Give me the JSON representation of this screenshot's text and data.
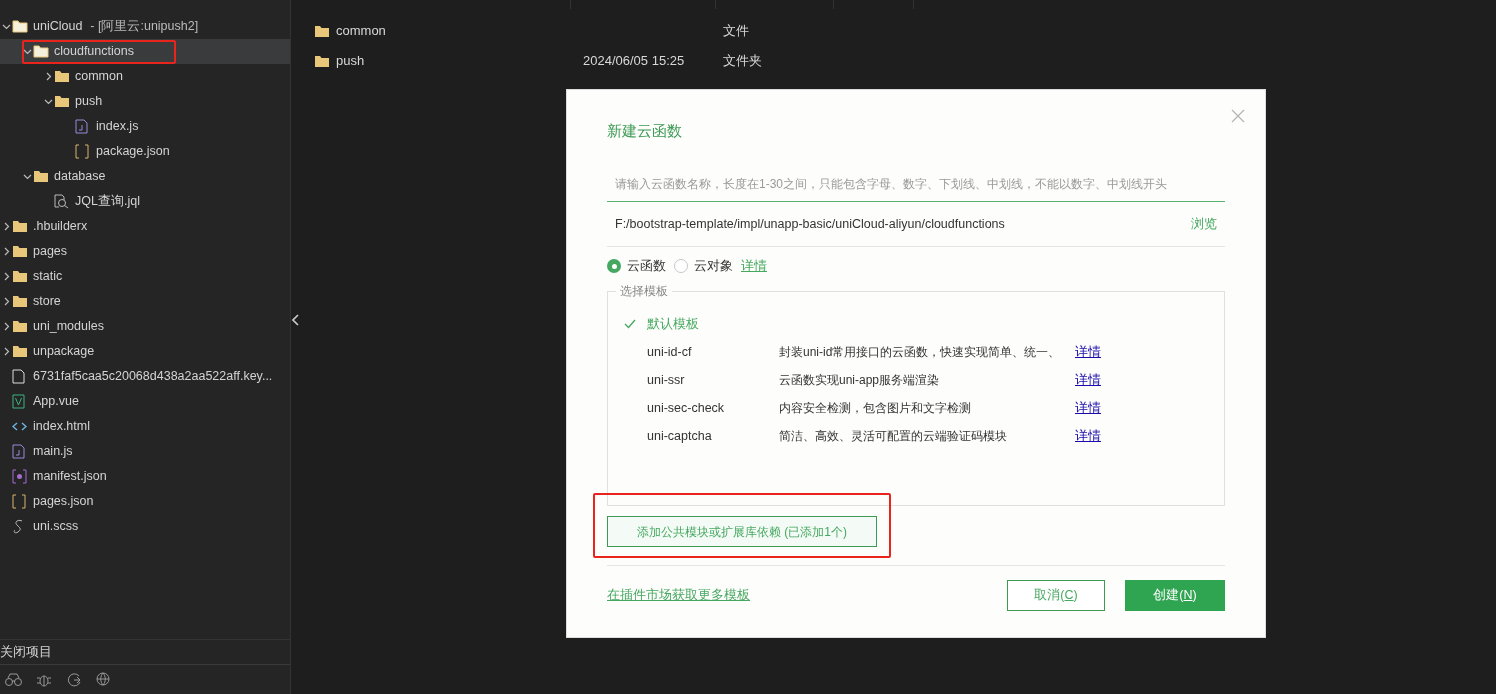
{
  "tree": [
    {
      "label": "uniCloud",
      "sublabel": "- [阿里云:unipush2]",
      "kind": "folder-open",
      "expanded": true,
      "selected": false,
      "children": [
        {
          "label": "cloudfunctions",
          "kind": "folder-open",
          "expanded": true,
          "selected": true,
          "annotated": true,
          "children": [
            {
              "label": "common",
              "kind": "folder",
              "expanded": false,
              "selected": false
            },
            {
              "label": "push",
              "kind": "folder",
              "expanded": true,
              "selected": false,
              "children": [
                {
                  "label": "index.js",
                  "kind": "js",
                  "selected": false
                },
                {
                  "label": "package.json",
                  "kind": "json",
                  "selected": false
                }
              ]
            }
          ]
        },
        {
          "label": "database",
          "kind": "folder",
          "expanded": true,
          "selected": false,
          "children": [
            {
              "label": "JQL查询.jql",
              "kind": "jql",
              "selected": false
            }
          ]
        }
      ]
    },
    {
      "label": ".hbuilderx",
      "kind": "folder",
      "expanded": false,
      "selected": false
    },
    {
      "label": "pages",
      "kind": "folder",
      "expanded": false,
      "selected": false
    },
    {
      "label": "static",
      "kind": "folder",
      "expanded": false,
      "selected": false
    },
    {
      "label": "store",
      "kind": "folder",
      "expanded": false,
      "selected": false
    },
    {
      "label": "uni_modules",
      "kind": "folder",
      "expanded": false,
      "selected": false
    },
    {
      "label": "unpackage",
      "kind": "folder",
      "expanded": false,
      "selected": false
    },
    {
      "label": "6731faf5caa5c20068d438a2aa522aff.key...",
      "kind": "file",
      "selected": false
    },
    {
      "label": "App.vue",
      "kind": "vue",
      "selected": false
    },
    {
      "label": "index.html",
      "kind": "html",
      "selected": false
    },
    {
      "label": "main.js",
      "kind": "js",
      "selected": false
    },
    {
      "label": "manifest.json",
      "kind": "manifest",
      "selected": false
    },
    {
      "label": "pages.json",
      "kind": "json",
      "selected": false
    },
    {
      "label": "uni.scss",
      "kind": "scss",
      "selected": false
    }
  ],
  "closed_projects": "关闭项目",
  "files": [
    {
      "name": "common",
      "type": "文件"
    },
    {
      "name": "push",
      "modified": "2024/06/05 15:25",
      "type": "文件夹"
    }
  ],
  "dialog": {
    "title": "新建云函数",
    "name_field": {
      "placeholder": "请输入云函数名称，长度在1-30之间，只能包含字母、数字、下划线、中划线，不能以数字、中划线开头"
    },
    "path": "F:/bootstrap-template/impl/unapp-basic/uniCloud-aliyun/cloudfunctions",
    "browse": "浏览",
    "types": [
      {
        "label": "云函数",
        "selected": true
      },
      {
        "label": "云对象",
        "selected": false
      }
    ],
    "types_link": "详情",
    "template_legend": "选择模板",
    "templates": [
      {
        "name": "默认模板",
        "selected": true
      },
      {
        "name": "uni-id-cf",
        "description": "封装uni-id常用接口的云函数，快速实现简单、统一、",
        "link": "详情",
        "selected": false
      },
      {
        "name": "uni-ssr",
        "description": "云函数实现uni-app服务端渲染",
        "link": "详情",
        "selected": false
      },
      {
        "name": "uni-sec-check",
        "description": "内容安全检测，包含图片和文字检测",
        "link": "详情",
        "selected": false
      },
      {
        "name": "uni-captcha",
        "description": "简洁、高效、灵活可配置的云端验证码模块",
        "link": "详情",
        "selected": false
      }
    ],
    "dependency_button": {
      "label": "添加公共模块或扩展库依赖 (已添加1个)",
      "annotated": true
    },
    "market_link": "在插件市场获取更多模板",
    "cancel": {
      "label": "取消(",
      "key": "C",
      ")": ")"
    },
    "create": {
      "label": "创建(",
      "key": "N",
      ")": ")"
    }
  }
}
